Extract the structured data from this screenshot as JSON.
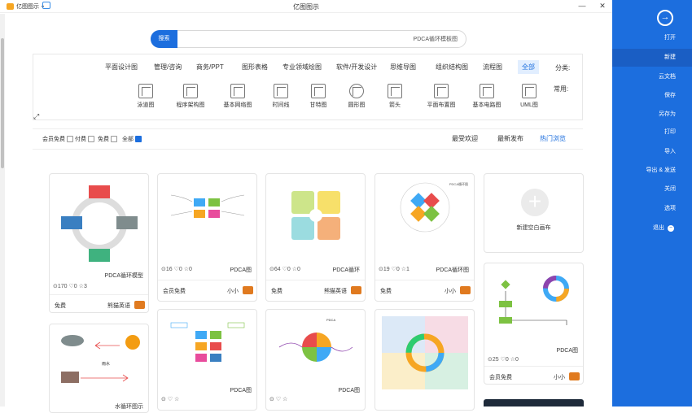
{
  "window": {
    "title": "亿图图示",
    "brand": "亿图图示",
    "minimize": "—",
    "close": "✕"
  },
  "sidebar": {
    "back_icon": "arrow-right-circle-icon",
    "items": [
      {
        "label": "打开",
        "active": false
      },
      {
        "label": "新建",
        "active": true
      },
      {
        "label": "云文档",
        "active": false
      },
      {
        "label": "保存",
        "active": false
      },
      {
        "label": "另存为",
        "active": false
      },
      {
        "label": "打印",
        "active": false
      },
      {
        "label": "导入",
        "active": false
      },
      {
        "label": "导出 & 发送",
        "active": false
      },
      {
        "label": "关闭",
        "active": false
      },
      {
        "label": "选项",
        "active": false
      },
      {
        "label": "退出",
        "active": false
      }
    ]
  },
  "search": {
    "button": "搜索",
    "value": "PDCA循环模板图"
  },
  "categories": {
    "label": "分类:",
    "items": [
      {
        "label": "全部",
        "active": true
      },
      {
        "label": "流程图"
      },
      {
        "label": "组织结构图"
      },
      {
        "label": "思维导图"
      },
      {
        "label": "软件/开发设计"
      },
      {
        "label": "专业领域绘图"
      },
      {
        "label": "图形表格"
      },
      {
        "label": "商务/PPT"
      },
      {
        "label": "管理/咨询"
      },
      {
        "label": "平面设计图"
      }
    ]
  },
  "common": {
    "label": "常用:",
    "items": [
      {
        "label": "UML图"
      },
      {
        "label": "基本电路图"
      },
      {
        "label": "平面布置图"
      },
      {
        "label": "箭头"
      },
      {
        "label": "圆形图"
      },
      {
        "label": "甘特图"
      },
      {
        "label": "时间线"
      },
      {
        "label": "基本网络图"
      },
      {
        "label": "程序架构图"
      },
      {
        "label": "泳道图"
      }
    ]
  },
  "sort": {
    "items": [
      {
        "label": "热门浏览",
        "active": true
      },
      {
        "label": "最新发布",
        "active": false
      },
      {
        "label": "最受欢迎",
        "active": false
      }
    ]
  },
  "filters": [
    {
      "label": "全部",
      "checked": true
    },
    {
      "label": "免费",
      "checked": false
    },
    {
      "label": "付费",
      "checked": false
    },
    {
      "label": "会员免费",
      "checked": false
    }
  ],
  "new_canvas": {
    "label": "新建空白画布"
  },
  "cards": [
    {
      "name": "PDCA循环图",
      "views": "19",
      "likes": "0",
      "stars": "1",
      "author": "小小",
      "price": "免费"
    },
    {
      "name": "PDCA循环",
      "views": "64",
      "likes": "0",
      "stars": "0",
      "author": "熊猫英语",
      "price": "免费"
    },
    {
      "name": "PDCA图",
      "views": "16",
      "likes": "0",
      "stars": "0",
      "author": "小小",
      "price": "会员免费"
    },
    {
      "name": "PDCA循环模型",
      "views": "170",
      "likes": "0",
      "stars": "3",
      "author": "熊猫英语",
      "price": "免费"
    },
    {
      "name": "PDCA图",
      "views": "25",
      "likes": "0",
      "stars": "0",
      "author": "小小",
      "price": "会员免费"
    },
    {
      "name": "PDCA图",
      "views": "",
      "likes": "",
      "stars": "",
      "author": "",
      "price": ""
    },
    {
      "name": "PDCA图",
      "views": "",
      "likes": "",
      "stars": "",
      "author": "",
      "price": ""
    },
    {
      "name": "水循环图示",
      "views": "",
      "likes": "",
      "stars": "",
      "author": "",
      "price": ""
    }
  ],
  "thumb_text": {
    "pdca_a": "PDCA循环图",
    "word_mid": "高效率",
    "sunrain": "雨水",
    "tag": "PDCA"
  }
}
